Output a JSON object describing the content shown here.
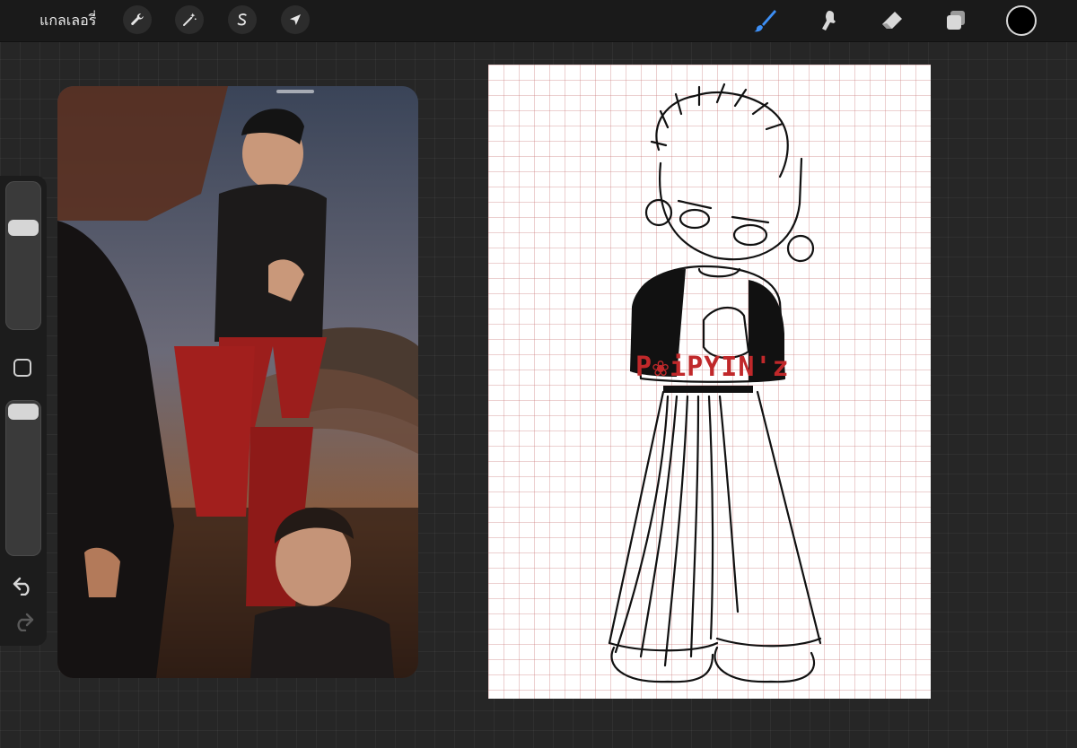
{
  "toolbar": {
    "gallery_label": "แกลเลอรี่",
    "left_tools": [
      "wrench-icon",
      "magic-wand-icon",
      "selection-s-icon",
      "arrow-transform-icon"
    ],
    "right_tools": [
      "brush-icon",
      "smudge-icon",
      "eraser-icon",
      "layers-icon"
    ],
    "active_tool": "brush-icon",
    "accent_color": "#3d8ff5",
    "current_color": "#000000"
  },
  "sidebar": {
    "brush_size": 0.72,
    "opacity": 1.0,
    "icons": [
      "modify-square-icon",
      "undo-icon",
      "redo-icon"
    ]
  },
  "reference": {
    "kind": "photo-reference"
  },
  "canvas": {
    "background": "#ffffff",
    "grid_color": "#d88888",
    "watermark": "P❀iPYIN'z",
    "watermark_color": "#c0282a"
  }
}
